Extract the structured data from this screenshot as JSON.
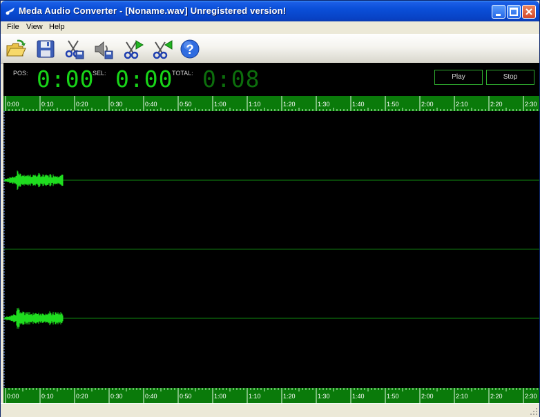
{
  "window": {
    "title": "Meda Audio Converter - [Noname.wav] Unregistered version!",
    "controls": [
      "minimize",
      "maximize",
      "close"
    ]
  },
  "menu": {
    "items": [
      "File",
      "View",
      "Help"
    ]
  },
  "toolbar": {
    "icons": [
      "open-folder-icon",
      "save-icon",
      "cut-save-icon",
      "speaker-save-icon",
      "cut-forward-icon",
      "cut-back-icon",
      "help-icon"
    ]
  },
  "display": {
    "pos_label": "POS:",
    "pos_value": "0:00",
    "sel_label": "SEL:",
    "sel_value": "0:00",
    "total_label": "TOTAL:",
    "total_value": "0:08",
    "play_label": "Play",
    "stop_label": "Stop"
  },
  "timeline": {
    "labels": [
      "0:00",
      "0:10",
      "0:20",
      "0:30",
      "0:40",
      "0:50",
      "1:00",
      "1:10",
      "1:20",
      "1:30",
      "1:40",
      "1:50",
      "2:00",
      "2:10",
      "2:20",
      "2:30"
    ]
  },
  "colors": {
    "accent_green": "#18d418",
    "ruler_green": "#0a7a0a",
    "wave_green": "#1fdc1f",
    "titlebar_blue": "#0a4fd8"
  }
}
